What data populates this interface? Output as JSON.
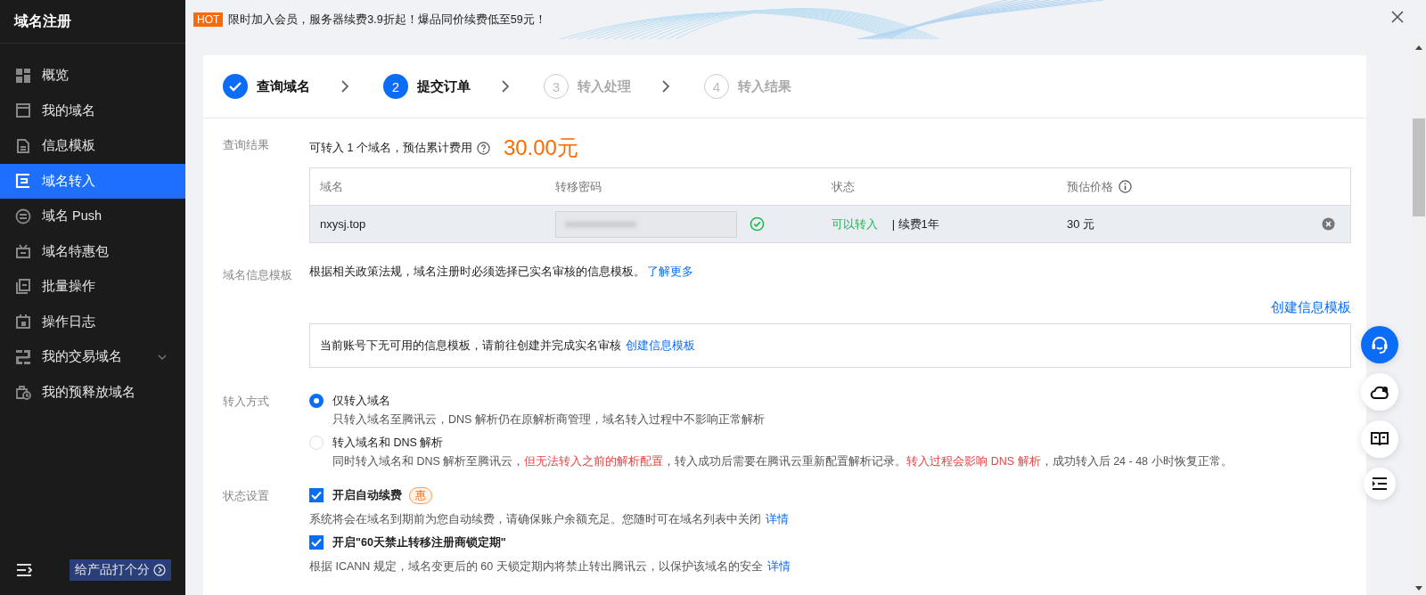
{
  "sidebar": {
    "title": "域名注册",
    "items": [
      {
        "label": "概览",
        "selected": false
      },
      {
        "label": "我的域名",
        "selected": false
      },
      {
        "label": "信息模板",
        "selected": false
      },
      {
        "label": "域名转入",
        "selected": true
      },
      {
        "label": "域名 Push",
        "selected": false
      },
      {
        "label": "域名特惠包",
        "selected": false
      },
      {
        "label": "批量操作",
        "selected": false
      },
      {
        "label": "操作日志",
        "selected": false
      },
      {
        "label": "我的交易域名",
        "selected": false,
        "expandable": true,
        "expanded": false
      },
      {
        "label": "我的预释放域名",
        "selected": false
      }
    ],
    "feedback": "给产品打个分"
  },
  "banner": {
    "badge": "HOT",
    "text": "限时加入会员，服务器续费3.9折起！爆品同价续费低至59元！"
  },
  "steps": [
    {
      "label": "查询域名",
      "kind": "done"
    },
    {
      "number": "2",
      "label": "提交订单",
      "kind": "current"
    },
    {
      "number": "3",
      "label": "转入处理",
      "kind": "pending"
    },
    {
      "number": "4",
      "label": "转入结果",
      "kind": "pending"
    }
  ],
  "query_result": {
    "label": "查询结果",
    "summary": "可转入 1 个域名，预估累计费用",
    "total": "30.00元",
    "columns": [
      {
        "title": "域名"
      },
      {
        "title": "转移密码"
      },
      {
        "title": "状态"
      },
      {
        "title": "预估价格",
        "info": true
      }
    ],
    "rows": [
      {
        "domain": "nxysj.top",
        "code_valid": true,
        "status": "可以转入",
        "note": "| 续费1年",
        "price": "30 元"
      }
    ]
  },
  "template": {
    "label": "域名信息模板",
    "text": "根据相关政策法规，域名注册时必须选择已实名审核的信息模板。",
    "link": "了解更多",
    "create_link": "创建信息模板",
    "empty_text": "当前账号下无可用的信息模板，请前往创建并完成实名审核",
    "empty_link": "创建信息模板"
  },
  "transfer_method": {
    "label": "转入方式",
    "options": [
      {
        "title": "仅转入域名",
        "selected": true,
        "description": [
          {
            "text": "只转入域名至腾讯云，DNS 解析仍在原解析商管理，域名转入过程中不影响正常解析",
            "kind": "normal"
          }
        ]
      },
      {
        "title": "转入域名和 DNS 解析",
        "selected": false,
        "description": [
          {
            "text": "同时转入域名和 DNS 解析至腾讯云，",
            "kind": "normal"
          },
          {
            "text": "但无法转入之前的解析配置",
            "kind": "warning"
          },
          {
            "text": "，转入成功后需要在腾讯云重新配置解析记录。",
            "kind": "normal"
          },
          {
            "text": "转入过程会影响 DNS 解析",
            "kind": "warning"
          },
          {
            "text": "，成功转入后 24 - 48 小时恢复正常。",
            "kind": "normal"
          }
        ]
      }
    ]
  },
  "status_settings": {
    "label": "状态设置",
    "options": [
      {
        "title": "开启自动续费",
        "tag": "惠",
        "checked": true,
        "description": "系统将会在域名到期前为您自动续费，请确保账户余额充足。您随时可在域名列表中关闭",
        "link": "详情"
      },
      {
        "title": "开启\"60天禁止转移注册商锁定期\"",
        "checked": true,
        "description": "根据 ICANN 规定，域名变更后的 60 天锁定期内将禁止转出腾讯云，以保护该域名的安全",
        "link": "详情"
      }
    ]
  }
}
